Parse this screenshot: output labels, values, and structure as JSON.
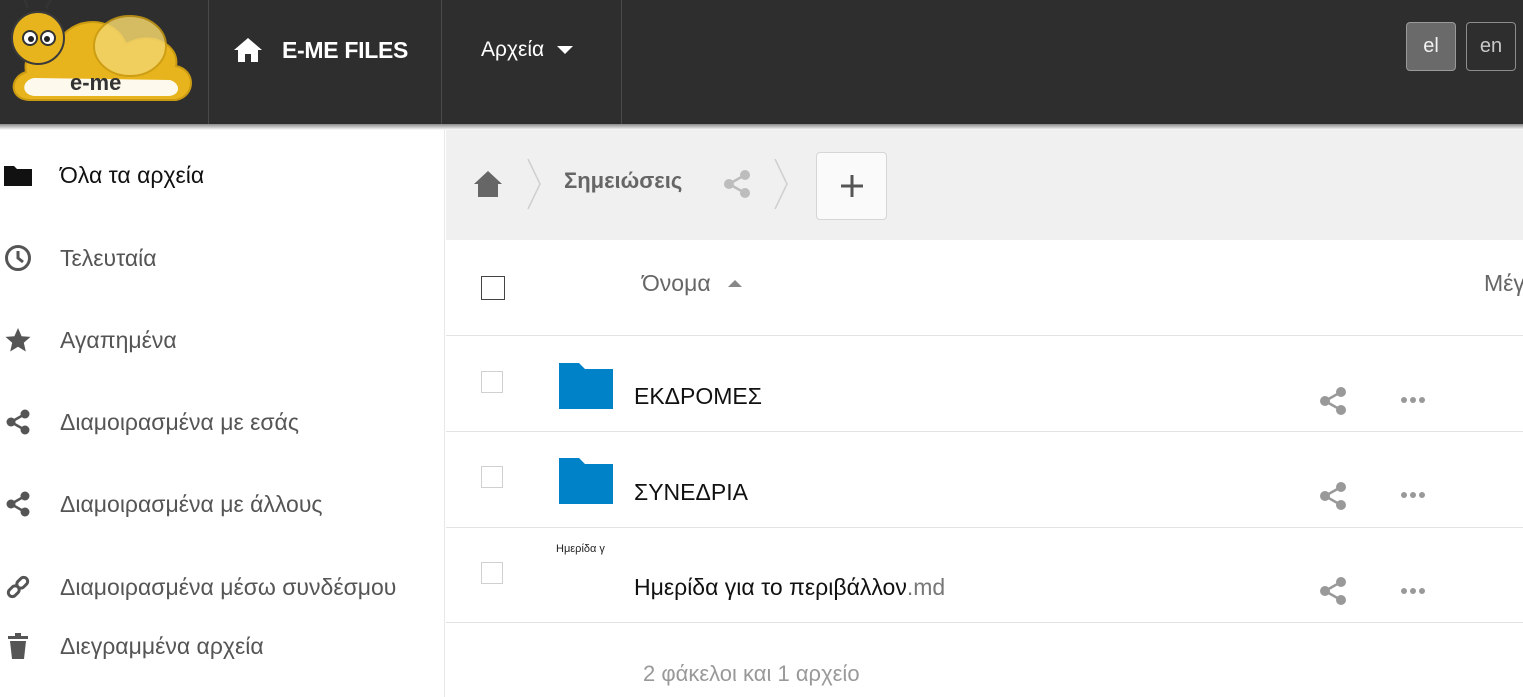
{
  "header": {
    "logo_text": "e-me",
    "brand": "E-ME FILES",
    "menu_label": "Αρχεία",
    "languages": [
      "el",
      "en"
    ],
    "active_language": "el"
  },
  "sidebar": {
    "items": [
      {
        "label": "Όλα τα αρχεία",
        "icon": "folder-icon",
        "active": true
      },
      {
        "label": "Τελευταία",
        "icon": "clock-icon"
      },
      {
        "label": "Αγαπημένα",
        "icon": "star-icon"
      },
      {
        "label": "Διαμοιρασμένα με εσάς",
        "icon": "share-icon"
      },
      {
        "label": "Διαμοιρασμένα με άλλους",
        "icon": "share-icon"
      },
      {
        "label": "Διαμοιρασμένα μέσω συνδέσμου",
        "icon": "link-icon"
      },
      {
        "label": "Διεγραμμένα αρχεία",
        "icon": "trash-icon"
      }
    ]
  },
  "breadcrumb": {
    "current": "Σημειώσεις",
    "add_symbol": "+"
  },
  "table": {
    "col_name": "Όνομα",
    "col_size": "Μέγεθος",
    "rows": [
      {
        "name": "ΕΚΔΡΟΜΕΣ",
        "ext": "",
        "type": "folder"
      },
      {
        "name": "ΣΥΝΕΔΡΙΑ",
        "ext": "",
        "type": "folder"
      },
      {
        "name": "Ημερίδα για το περιβάλλον",
        "ext": ".md",
        "type": "file",
        "preview_text": "Ημερίδα γ"
      }
    ],
    "summary": "2 φάκελοι και 1 αρχείο"
  },
  "colors": {
    "header_bg": "#2e2e2e",
    "folder_blue": "#0082c9",
    "logo_yellow": "#e7b41d",
    "crumb_bg": "#f0f0f0"
  }
}
